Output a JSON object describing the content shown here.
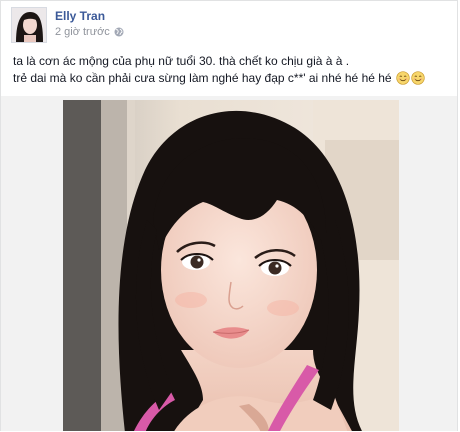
{
  "post": {
    "author": "Elly Tran",
    "timestamp": "2 giờ trước",
    "privacy_icon": "globe-icon",
    "text_lines": [
      "ta là cơn ác mộng của phụ nữ tuổi 30. thà chết ko chịu già à à .",
      "trẻ dai mà ko cần phải cưa sừng làm nghé hay đạp c**' ai nhé hé hé hé"
    ],
    "emoji_icons": [
      "smiling-face-icon",
      "smiling-face-icon"
    ],
    "photo_icon": "selfie-photo"
  },
  "colors": {
    "author_link": "#3b5998",
    "meta_text": "#90949c",
    "body_text": "#141823",
    "border": "#e1e2e3"
  }
}
